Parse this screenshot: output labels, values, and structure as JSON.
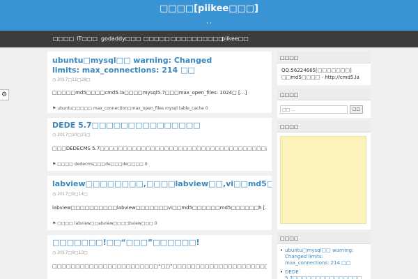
{
  "header": {
    "title": "□□□□[piikee□□□]",
    "description": ",                           ,"
  },
  "nav": {
    "items": [
      "□□□□",
      "IT□□□",
      "godaddy□□□",
      "□□□□□",
      "□□□□□",
      "□□□□□",
      "piikee□□"
    ]
  },
  "side_tab": {
    "icon": "gear-icon",
    "glyph": "⚙"
  },
  "posts": [
    {
      "title": "ubuntu□mysql□□ warning: Changed limits: max_connections: 214 □□",
      "date": "2017□11□28□",
      "excerpt": "□□□□□md5□□□□cmd5.la□□□□mysql5.7□□□max_open_files: 1024□ […]",
      "meta": "ubuntu□□□□□ max_connection□max_open_files mysql table_cache  0"
    },
    {
      "title": "DEDE 5.7□□□□□□□□□□□□□□□",
      "date": "2017□10□21□",
      "excerpt": "□□□DEDECMS 5.7□□□□□□□□□□□□□□□□□□□□□□□□□□□□□□□□□□□□□□□□□□□□ […]",
      "meta": "□□□□ dedecms□□□de□□□de□□□□  0"
    },
    {
      "title": "labview□□□□□□□□,□□□□labview□□,vi□□md5□□□",
      "date": "2017□9□14□",
      "excerpt": "labview□□□□□□□□□□labview□□□□□□□vi□□md5□□□□□□md5□□□□□□h […]",
      "meta": "□□□□ labview□□abview□□□□bview□□□  0"
    },
    {
      "title": "□□□□□□□!□□“□□□”□□□□□□!",
      "date": "2017□9□13□",
      "excerpt": "□□□□□□□□□□□□□□□□□□□□□□□“□□”□□□□□□□□□□□□□□□□□□□□□□□ […]"
    }
  ],
  "sidebar": {
    "contact": {
      "title": "□□□□",
      "line1": "QQ:56224665[□□□□□□□]",
      "line2": "□□md5□□□□ - http://cmd5.la"
    },
    "search": {
      "title": "□□□□",
      "placeholder": "□□ ...",
      "button": "□□"
    },
    "ad": {
      "title": "□□□□"
    },
    "recent": {
      "title": "□□□□",
      "items": [
        "ubuntu□mysql□□ warning: Changed limits: max_connections: 214 □□",
        "DEDE 5.7□□□□□□□□□□□□□□□"
      ]
    }
  },
  "colors": {
    "header_bg": "#3a93d3",
    "nav_bg": "#3d3d3d",
    "link": "#3a87bf",
    "ad_bg": "#fbf3b9"
  }
}
